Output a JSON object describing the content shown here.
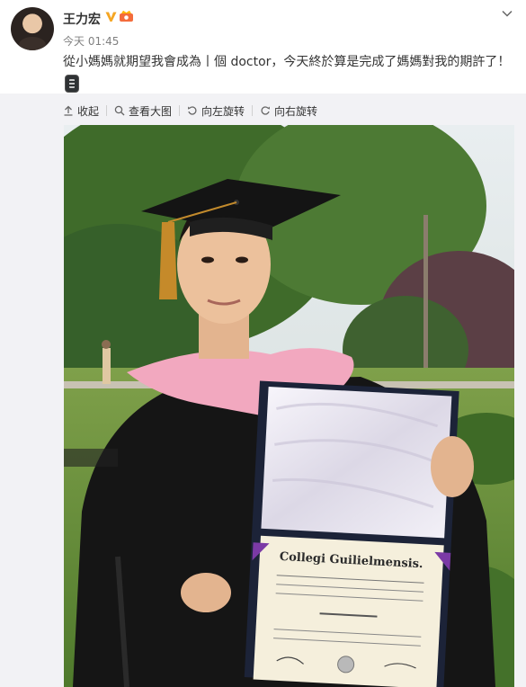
{
  "post": {
    "username": "王力宏",
    "timestamp": "今天 01:45",
    "text": "從小媽媽就期望我會成為丨個 doctor，今天終於算是完成了媽媽對我的期許了！"
  },
  "toolbar": {
    "collapse": "收起",
    "view_large": "查看大图",
    "rotate_left": "向左旋转",
    "rotate_right": "向右旋转"
  },
  "photo": {
    "diploma_heading": "Collegi Guilielmensis."
  },
  "colors": {
    "verified": "#f5a623",
    "toolbar_bg": "#f2f2f5",
    "gown": "#111111",
    "hood": "#f2a8bf"
  }
}
